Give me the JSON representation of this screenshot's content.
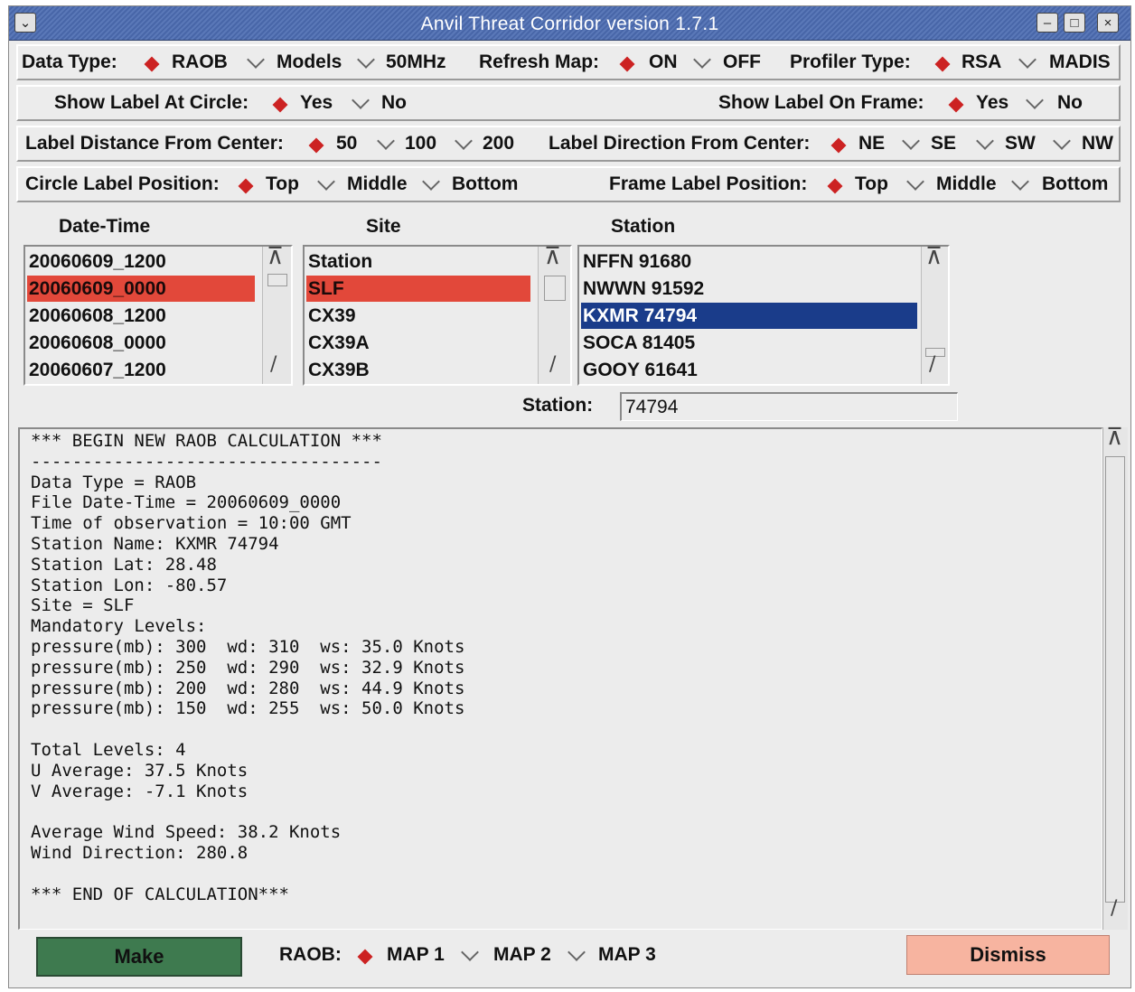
{
  "window": {
    "title": "Anvil Threat Corridor version 1.7.1",
    "buttons": {
      "menu": "⌄",
      "minimize": "‒",
      "maximize": "□",
      "close": "×"
    }
  },
  "row1": {
    "data_type_label": "Data Type:",
    "data_type_options": [
      "RAOB",
      "Models",
      "50MHz"
    ],
    "data_type_selected": "RAOB",
    "refresh_map_label": "Refresh Map:",
    "refresh_map_options": [
      "ON",
      "OFF"
    ],
    "refresh_map_selected": "ON",
    "profiler_type_label": "Profiler Type:",
    "profiler_type_options": [
      "RSA",
      "MADIS"
    ],
    "profiler_type_selected": "RSA"
  },
  "row2": {
    "show_label_circle_label": "Show Label At Circle:",
    "show_label_circle_options": [
      "Yes",
      "No"
    ],
    "show_label_circle_selected": "Yes",
    "show_label_frame_label": "Show Label On Frame:",
    "show_label_frame_options": [
      "Yes",
      "No"
    ],
    "show_label_frame_selected": "Yes"
  },
  "row3": {
    "label_distance_label": "Label Distance From Center:",
    "label_distance_options": [
      "50",
      "100",
      "200"
    ],
    "label_distance_selected": "50",
    "label_direction_label": "Label Direction From Center:",
    "label_direction_options": [
      "NE",
      "SE",
      "SW",
      "NW"
    ],
    "label_direction_selected": "NE"
  },
  "row4": {
    "circle_position_label": "Circle Label Position:",
    "circle_position_options": [
      "Top",
      "Middle",
      "Bottom"
    ],
    "circle_position_selected": "Top",
    "frame_position_label": "Frame Label Position:",
    "frame_position_options": [
      "Top",
      "Middle",
      "Bottom"
    ],
    "frame_position_selected": "Top"
  },
  "lists": {
    "datetime": {
      "header": "Date-Time",
      "items": [
        "20060609_1200",
        "20060609_0000",
        "20060608_1200",
        "20060608_0000",
        "20060607_1200"
      ],
      "selected_index": 1,
      "selected_color": "#e2483a"
    },
    "site": {
      "header": "Site",
      "items": [
        "Station",
        "SLF",
        "CX39",
        "CX39A",
        "CX39B"
      ],
      "selected_index": 1,
      "selected_color": "#e2483a"
    },
    "station": {
      "header": "Station",
      "items": [
        "NFFN 91680",
        "NWWN 91592",
        "KXMR 74794",
        "SOCA 81405",
        "GOOY 61641"
      ],
      "selected_index": 2,
      "selected_color": "#1a3c8a"
    }
  },
  "station_field": {
    "label": "Station:",
    "value": "74794"
  },
  "output_lines": [
    "*** BEGIN NEW RAOB CALCULATION ***",
    "----------------------------------",
    "Data Type = RAOB",
    "File Date-Time = 20060609_0000",
    "Time of observation = 10:00 GMT",
    "Station Name: KXMR 74794",
    "Station Lat: 28.48",
    "Station Lon: -80.57",
    "Site = SLF",
    "Mandatory Levels:",
    "pressure(mb): 300  wd: 310  ws: 35.0 Knots",
    "pressure(mb): 250  wd: 290  ws: 32.9 Knots",
    "pressure(mb): 200  wd: 280  ws: 44.9 Knots",
    "pressure(mb): 150  wd: 255  ws: 50.0 Knots",
    "",
    "Total Levels: 4",
    "U Average: 37.5 Knots",
    "V Average: -7.1 Knots",
    "",
    "Average Wind Speed: 38.2 Knots",
    "Wind Direction: 280.8",
    "",
    "*** END OF CALCULATION***"
  ],
  "bottom": {
    "make_label": "Make",
    "make_color": "#3e7a4f",
    "raob_label": "RAOB:",
    "map_options": [
      "MAP 1",
      "MAP 2",
      "MAP 3"
    ],
    "map_selected": "MAP 1",
    "dismiss_label": "Dismiss",
    "dismiss_color": "#f7b4a0"
  },
  "colors": {
    "radio_selected": "#cc2222",
    "title_bar": "#4f6eb0"
  }
}
